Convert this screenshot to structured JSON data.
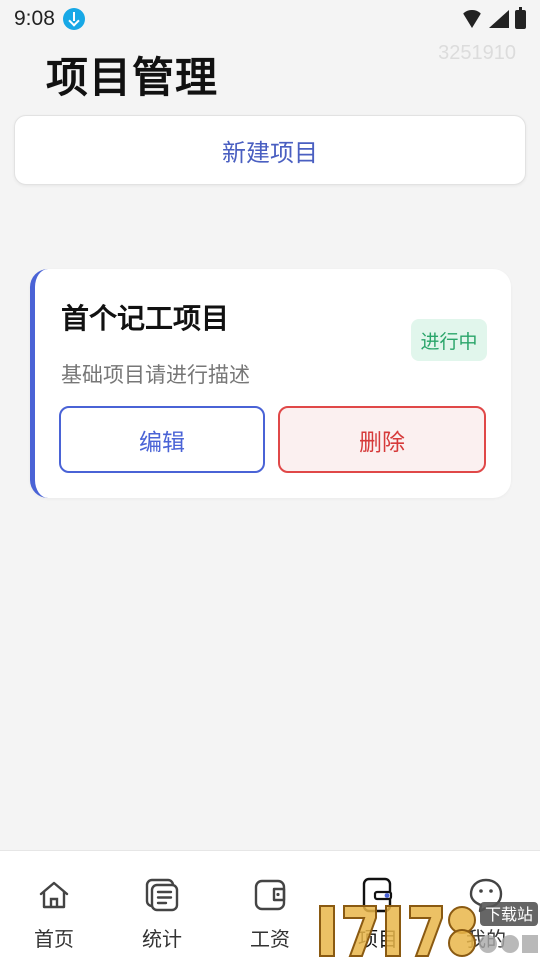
{
  "status_bar": {
    "time": "9:08"
  },
  "watermark_code": "3251910",
  "page_title": "项目管理",
  "new_project_label": "新建项目",
  "project": {
    "name": "首个记工项目",
    "status": "进行中",
    "description": "基础项目请进行描述",
    "edit_label": "编辑",
    "delete_label": "删除"
  },
  "nav": {
    "items": [
      {
        "label": "首页",
        "icon": "home-icon"
      },
      {
        "label": "统计",
        "icon": "stats-icon"
      },
      {
        "label": "工资",
        "icon": "wallet-icon"
      },
      {
        "label": "项目",
        "icon": "project-icon",
        "active": true
      },
      {
        "label": "我的",
        "icon": "profile-icon"
      }
    ]
  },
  "site_logo": {
    "text": "下载站"
  },
  "colors": {
    "accent": "#4a63d6",
    "danger": "#e04848",
    "success": "#2aa56a",
    "background": "#f4f4f4"
  }
}
